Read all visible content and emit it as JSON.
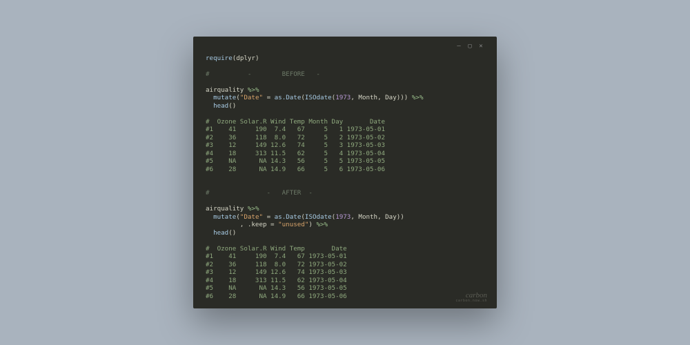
{
  "titlebar": {
    "min_label": "—",
    "max_label": "▢",
    "close_label": "✕"
  },
  "code": {
    "l1_require": "require",
    "l1_pkg": "dplyr",
    "l2_comment": "#          -        BEFORE   -",
    "l3_ident": "airquality",
    "l3_pipe": "%>%",
    "l4_mutate": "mutate",
    "l4_str_date": "\"Date\"",
    "l4_eq": " = ",
    "l4_asdate": "as.Date",
    "l4_isodate": "ISOdate",
    "l4_yr": "1973",
    "l4_month": ", Month, Day)))",
    "l4_pipe": "%>%",
    "l5_head": "head",
    "out1_hdr": "#  Ozone Solar.R Wind Temp Month Day       Date",
    "out1_r1": "#1    41     190  7.4   67     5   1 1973-05-01",
    "out1_r2": "#2    36     118  8.0   72     5   2 1973-05-02",
    "out1_r3": "#3    12     149 12.6   74     5   3 1973-05-03",
    "out1_r4": "#4    18     313 11.5   62     5   4 1973-05-04",
    "out1_r5": "#5    NA      NA 14.3   56     5   5 1973-05-05",
    "out1_r6": "#6    28      NA 14.9   66     5   6 1973-05-06",
    "l6_comment": "#               -   AFTER  -",
    "l7_ident": "airquality",
    "l7_pipe": "%>%",
    "l8_mutate": "mutate",
    "l8_str_date": "\"Date\"",
    "l8_eq": " = ",
    "l8_asdate": "as.Date",
    "l8_isodate": "ISOdate",
    "l8_yr": "1973",
    "l8_rest": ", Month, Day))",
    "l9_keep_lead": "         , .keep = ",
    "l9_keep_val": "\"unused\"",
    "l9_close": ")",
    "l9_pipe": "%>%",
    "l10_head": "head",
    "out2_hdr": "#  Ozone Solar.R Wind Temp       Date",
    "out2_r1": "#1    41     190  7.4   67 1973-05-01",
    "out2_r2": "#2    36     118  8.0   72 1973-05-02",
    "out2_r3": "#3    12     149 12.6   74 1973-05-03",
    "out2_r4": "#4    18     313 11.5   62 1973-05-04",
    "out2_r5": "#5    NA      NA 14.3   56 1973-05-05",
    "out2_r6": "#6    28      NA 14.9   66 1973-05-06"
  },
  "watermark": {
    "brand": "carbon",
    "sub": "carbon.now.sh"
  }
}
